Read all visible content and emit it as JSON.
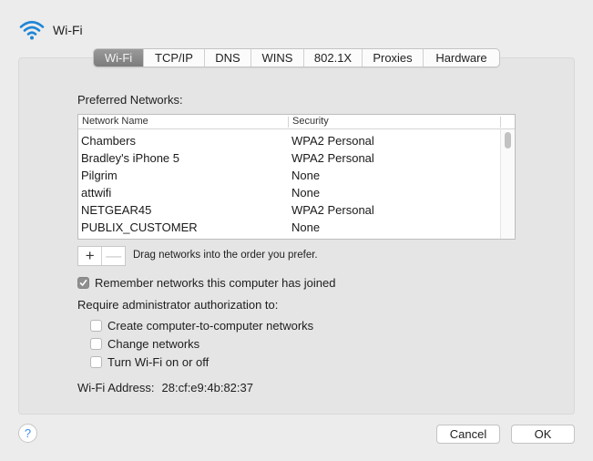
{
  "header": {
    "title": "Wi-Fi",
    "icon": "wifi-icon",
    "accent_color": "#1f86d6"
  },
  "tabs": [
    {
      "label": "Wi-Fi",
      "active": true
    },
    {
      "label": "TCP/IP",
      "active": false
    },
    {
      "label": "DNS",
      "active": false
    },
    {
      "label": "WINS",
      "active": false
    },
    {
      "label": "802.1X",
      "active": false
    },
    {
      "label": "Proxies",
      "active": false
    },
    {
      "label": "Hardware",
      "active": false
    }
  ],
  "preferred_networks": {
    "label": "Preferred Networks:",
    "columns": [
      "Network Name",
      "Security"
    ],
    "rows": [
      {
        "name": "Chambers",
        "security": "WPA2 Personal"
      },
      {
        "name": "Bradley's iPhone 5",
        "security": "WPA2 Personal"
      },
      {
        "name": "Pilgrim",
        "security": "None"
      },
      {
        "name": "attwifi",
        "security": "None"
      },
      {
        "name": "NETGEAR45",
        "security": "WPA2 Personal"
      },
      {
        "name": "PUBLIX_CUSTOMER",
        "security": "None"
      }
    ],
    "add_label": "+",
    "remove_label": "—",
    "hint": "Drag networks into the order you prefer."
  },
  "remember": {
    "label": "Remember networks this computer has joined",
    "checked": true
  },
  "admin": {
    "label": "Require administrator authorization to:",
    "options": [
      {
        "label": "Create computer-to-computer networks",
        "checked": false
      },
      {
        "label": "Change networks",
        "checked": false
      },
      {
        "label": "Turn Wi-Fi on or off",
        "checked": false
      }
    ]
  },
  "address": {
    "label": "Wi-Fi Address:",
    "value": "28:cf:e9:4b:82:37"
  },
  "footer": {
    "help_label": "?",
    "cancel_label": "Cancel",
    "ok_label": "OK"
  }
}
